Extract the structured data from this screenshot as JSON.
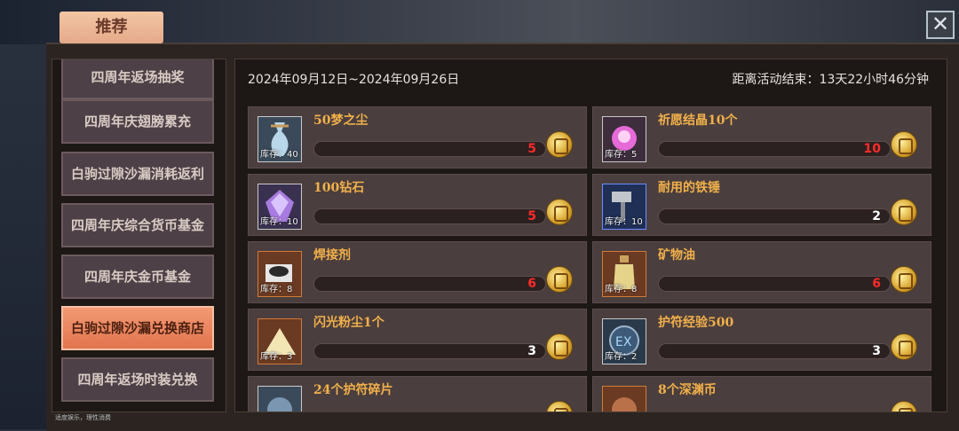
{
  "header": {
    "tab_label": "推荐",
    "close_symbol": "✕"
  },
  "sidebar": {
    "items": [
      {
        "label": "四周年返场抽奖",
        "active": false
      },
      {
        "label": "四周年庆翅膀累充",
        "active": false
      },
      {
        "label": "白驹过隙沙漏消耗返利",
        "active": false
      },
      {
        "label": "四周年庆综合货币基金",
        "active": false
      },
      {
        "label": "四周年庆金币基金",
        "active": false
      },
      {
        "label": "白驹过隙沙漏兑换商店",
        "active": true
      },
      {
        "label": "四周年返场时装兑换",
        "active": false
      }
    ]
  },
  "footer_note": "适度娱乐，理性消费",
  "event": {
    "date_range": "2024年09月12日~2024年09月26日",
    "countdown": "距离活动结束：13天22小时46分钟"
  },
  "shop": {
    "items": [
      {
        "name": "50梦之尘",
        "stock": "库存：40",
        "cost": "5",
        "cost_color": "#ff2b2b",
        "icon": "dust-pouch-icon",
        "icon_bg": "#3a4a5a"
      },
      {
        "name": "祈愿结晶10个",
        "stock": "库存：5",
        "cost": "10",
        "cost_color": "#ff2b2b",
        "icon": "pink-crystal-icon",
        "icon_bg": "#3d2d3d"
      },
      {
        "name": "100钻石",
        "stock": "库存：10",
        "cost": "5",
        "cost_color": "#ff2b2b",
        "icon": "purple-diamond-icon",
        "icon_bg": "#3a3050"
      },
      {
        "name": "耐用的铁锤",
        "stock": "库存：10",
        "cost": "2",
        "cost_color": "#ffffff",
        "icon": "hammer-icon",
        "icon_bg": "#1f2f55"
      },
      {
        "name": "焊接剂",
        "stock": "库存：8",
        "cost": "6",
        "cost_color": "#ff2b2b",
        "icon": "welding-agent-icon",
        "icon_bg": "#6a3a22"
      },
      {
        "name": "矿物油",
        "stock": "库存：8",
        "cost": "6",
        "cost_color": "#ff2b2b",
        "icon": "mineral-oil-icon",
        "icon_bg": "#6a3a22"
      },
      {
        "name": "闪光粉尘1个",
        "stock": "库存：3",
        "cost": "3",
        "cost_color": "#ffffff",
        "icon": "glitter-dust-icon",
        "icon_bg": "#6a3a22"
      },
      {
        "name": "护符经验500",
        "stock": "库存：2",
        "cost": "3",
        "cost_color": "#ffffff",
        "icon": "ex-charm-icon",
        "icon_bg": "#2a3a4a"
      },
      {
        "name": "24个护符碎片",
        "stock": "",
        "cost": "",
        "cost_color": "#ffffff",
        "icon": "charm-shard-icon",
        "icon_bg": "#3a4a5a"
      },
      {
        "name": "8个深渊币",
        "stock": "",
        "cost": "",
        "cost_color": "#ffffff",
        "icon": "abyss-coin-icon",
        "icon_bg": "#6a3a22"
      }
    ]
  }
}
